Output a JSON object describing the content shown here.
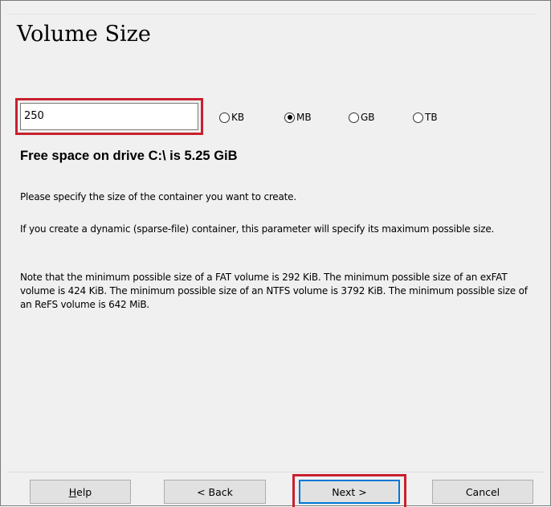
{
  "dialog": {
    "title": "Volume Size"
  },
  "size": {
    "value": "250",
    "units": [
      {
        "label": "KB",
        "selected": false
      },
      {
        "label": "MB",
        "selected": true
      },
      {
        "label": "GB",
        "selected": false
      },
      {
        "label": "TB",
        "selected": false
      }
    ]
  },
  "free_space": "Free space on drive C:\\ is 5.25 GiB",
  "paragraphs": [
    "Please specify the size of the container you want to create.",
    "If you create a dynamic (sparse-file) container, this parameter will specify its maximum possible size.",
    "Note that the minimum possible size of a FAT volume is 292 KiB. The minimum possible size of an exFAT volume is 424 KiB. The minimum possible size of an NTFS volume is 3792 KiB. The minimum possible size of an ReFS volume is 642 MiB."
  ],
  "buttons": {
    "help_first": "H",
    "help_rest": "elp",
    "back": "< Back",
    "next": "Next >",
    "cancel": "Cancel"
  },
  "colors": {
    "highlight": "#c8202e",
    "focus": "#0078d7"
  }
}
